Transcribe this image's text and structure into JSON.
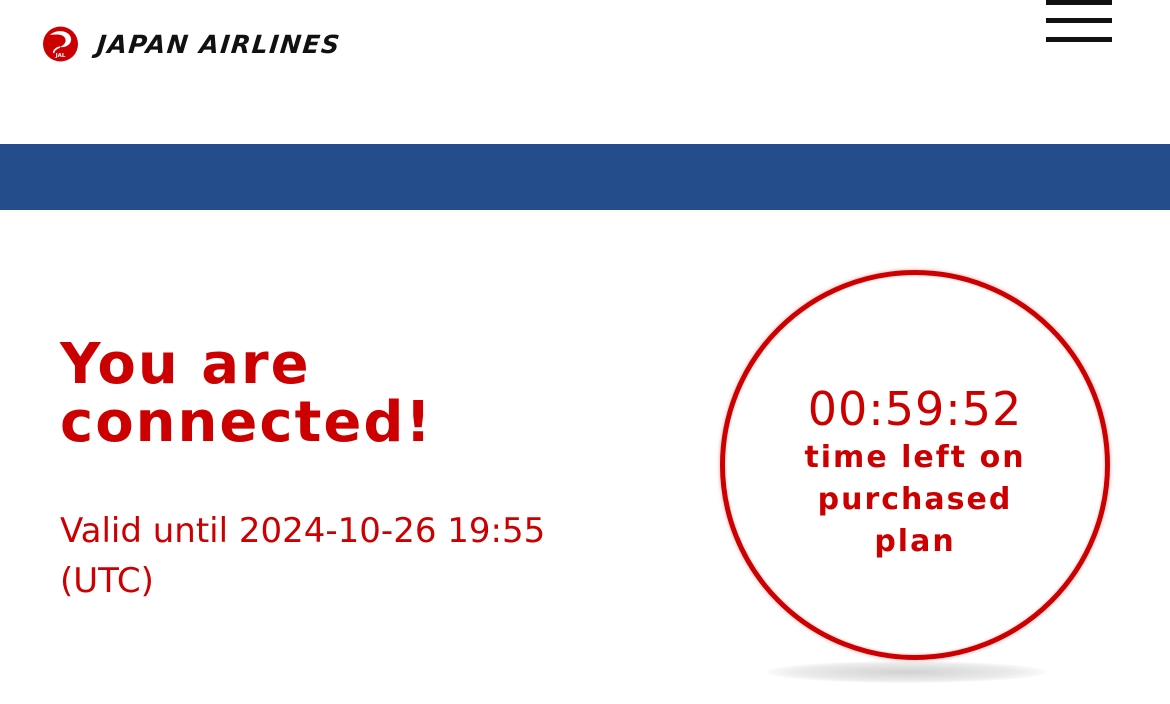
{
  "header": {
    "brand_name": "JAPAN AIRLINES",
    "logo_icon": "jal-crane-icon",
    "menu_icon": "hamburger-menu-icon"
  },
  "colors": {
    "brand_red": "#cc0000",
    "band_blue": "#244e8b",
    "text_dark": "#111111",
    "background": "#ffffff"
  },
  "status": {
    "title": "You are connected!",
    "valid_until": "Valid until 2024-10-26 19:55 (UTC)"
  },
  "timer": {
    "value": "00:59:52",
    "caption": "time left on purchased plan"
  }
}
